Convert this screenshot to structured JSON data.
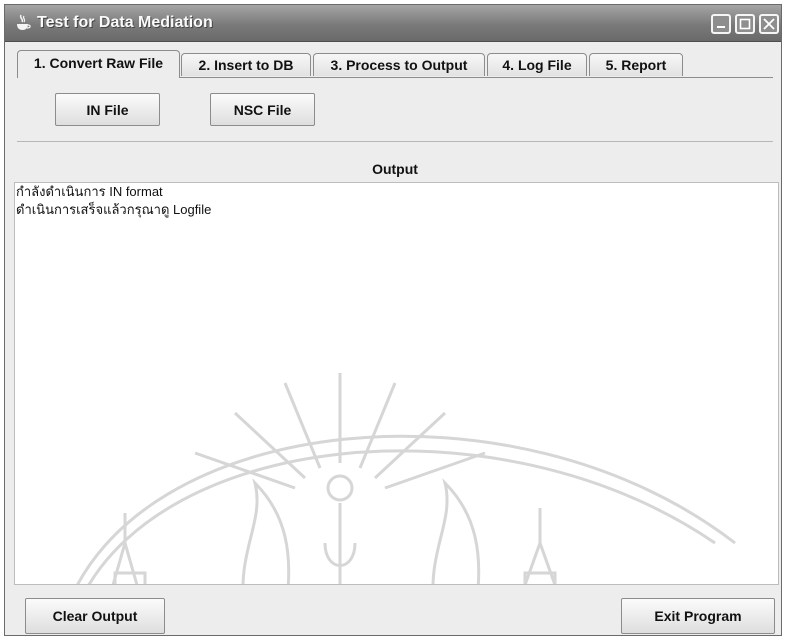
{
  "window": {
    "title": "Test for Data Mediation"
  },
  "tabs": [
    {
      "label": "1. Convert Raw File",
      "active": true
    },
    {
      "label": "2. Insert to DB",
      "active": false
    },
    {
      "label": "3. Process to Output",
      "active": false
    },
    {
      "label": "4. Log File",
      "active": false
    },
    {
      "label": "5. Report",
      "active": false
    }
  ],
  "toolbar": {
    "in_file": "IN File",
    "nsc_file": "NSC File"
  },
  "output": {
    "label": "Output",
    "lines": [
      "กำลังดำเนินการ IN format",
      "ดำเนินการเสร็จแล้วกรุณาดู Logfile"
    ]
  },
  "footer": {
    "clear": "Clear Output",
    "exit": "Exit Program"
  },
  "icons": {
    "app": "java-cup-icon",
    "minimize": "minimize-icon",
    "maximize": "maximize-icon",
    "close": "close-icon"
  }
}
